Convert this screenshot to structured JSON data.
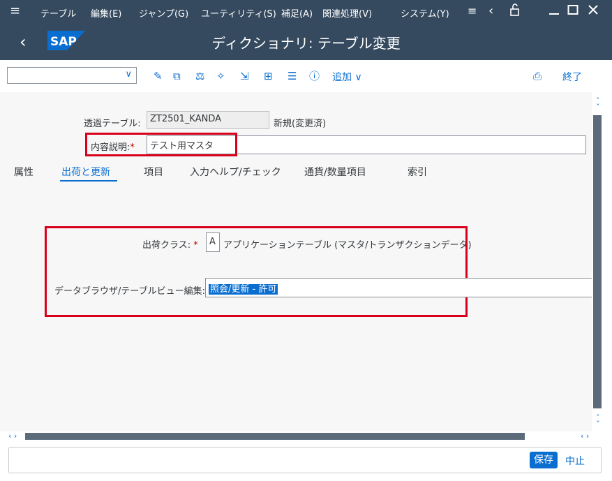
{
  "menubar": {
    "items": [
      "テーブル",
      "編集(E)",
      "ジャンプ(G)",
      "ユーティリティ(S)",
      "補足(A)",
      "関連処理(V)",
      "システム(Y)"
    ]
  },
  "title": "ディクショナリ: テーブル変更",
  "logo": "SAP",
  "toolbar": {
    "add_label": "追加",
    "exit_label": "終了"
  },
  "header": {
    "table_label": "透過テーブル:",
    "table_value": "ZT2501_KANDA",
    "status": "新規(変更済)",
    "desc_label": "内容説明:",
    "desc_value": "テスト用マスタ"
  },
  "tabs": [
    "属性",
    "出荷と更新",
    "項目",
    "入力ヘルプ/チェック",
    "通貨/数量項目",
    "索引"
  ],
  "delivery": {
    "class_label": "出荷クラス:",
    "class_value": "A",
    "class_desc": "アプリケーションテーブル (マスタ/トランザクションデータ)",
    "browser_label": "データブラウザ/テーブルビュー編集:",
    "browser_value": "照会/更新 - 許可"
  },
  "footer": {
    "save_label": "保存",
    "cancel_label": "中止"
  },
  "colors": {
    "shell": "#354a5f",
    "accent": "#0a6ed1",
    "highlight": "#d9001b"
  }
}
